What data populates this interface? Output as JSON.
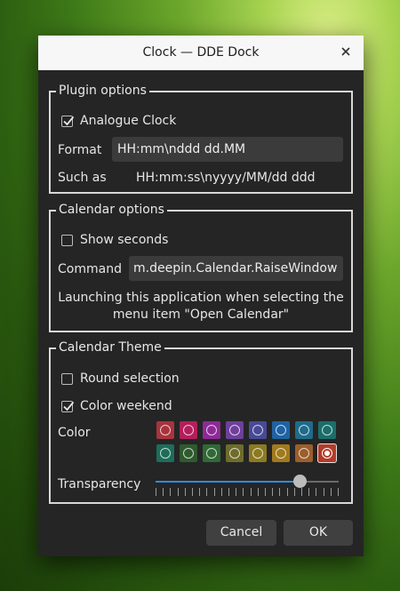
{
  "window": {
    "title": "Clock — DDE Dock"
  },
  "plugin_options": {
    "legend": "Plugin options",
    "analogue_clock": {
      "label": "Analogue Clock",
      "checked": true
    },
    "format_label": "Format",
    "format_value": "HH:mm\\nddd dd.MM",
    "such_as_label": "Such as",
    "such_as_value": "HH:mm:ss\\nyyyy/MM/dd ddd"
  },
  "calendar_options": {
    "legend": "Calendar options",
    "show_seconds": {
      "label": "Show seconds",
      "checked": false
    },
    "command_label": "Command",
    "command_value": "m.deepin.Calendar.RaiseWindow",
    "description_line1": "Launching this application when selecting the",
    "description_line2": "menu item \"Open Calendar\""
  },
  "calendar_theme": {
    "legend": "Calendar Theme",
    "round_selection": {
      "label": "Round selection",
      "checked": false
    },
    "color_weekend": {
      "label": "Color weekend",
      "checked": true
    },
    "color_label": "Color",
    "colors": [
      "#a8333d",
      "#b31f5a",
      "#8e2a97",
      "#6f3f9c",
      "#494a96",
      "#1f62a3",
      "#1e6b8a",
      "#1b6e6b",
      "#1d6d5a",
      "#2f5a2e",
      "#2f6a34",
      "#6e6c2a",
      "#8b7a21",
      "#a27a1c",
      "#9b5f2b",
      "#b23c2a"
    ],
    "selected_color_index": 15,
    "transparency_label": "Transparency",
    "transparency_value": 0.81
  },
  "buttons": {
    "cancel": "Cancel",
    "ok": "OK"
  }
}
